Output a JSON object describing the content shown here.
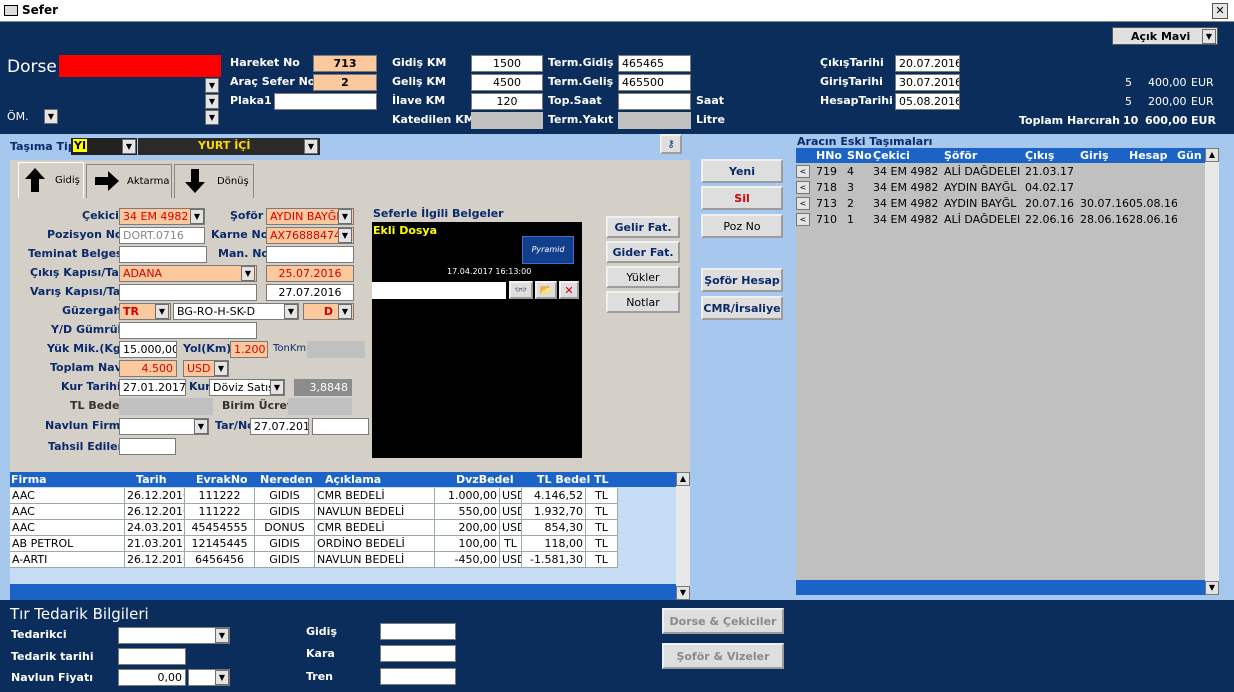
{
  "window": {
    "title": "Sefer",
    "close": "✕"
  },
  "theme": {
    "selected": "Açık Mavi"
  },
  "header": {
    "dorse_label": "Dorse",
    "om_label": "ÖM.",
    "hareket_no_label": "Hareket No",
    "hareket_no": "713",
    "arac_sefer_no_label": "Araç Sefer No",
    "arac_sefer_no": "2",
    "plaka1_label": "Plaka1",
    "plaka1": "",
    "gidis_km_label": "Gidiş KM",
    "gidis_km": "1500",
    "gelis_km_label": "Geliş KM",
    "gelis_km": "4500",
    "ilave_km_label": "İlave KM",
    "ilave_km": "120",
    "katedilen_km_label": "Katedilen KM",
    "term_gidis_label": "Term.Gidiş",
    "term_gidis": "465465",
    "term_gelis_label": "Term.Geliş",
    "term_gelis": "465500",
    "top_saat_label": "Top.Saat",
    "saat_label": "Saat",
    "term_yakit_label": "Term.Yakıt",
    "litre_label": "Litre",
    "cikis_tarihi_label": "ÇıkışTarihi",
    "cikis_tarihi": "20.07.2016",
    "giris_tarihi_label": "GirişTarihi",
    "giris_tarihi": "30.07.2016",
    "hesap_tarihi_label": "HesapTarihi",
    "hesap_tarihi": "05.08.2016",
    "harc1": [
      "5",
      "400,00",
      "EUR"
    ],
    "harc2": [
      "5",
      "200,00",
      "EUR"
    ],
    "toplam_harcirah_label": "Toplam Harcırah",
    "toplam": [
      "10",
      "600,00",
      "EUR"
    ]
  },
  "tasima": {
    "label": "Taşıma Tipi",
    "code": "YI",
    "type": "YURT İÇİ"
  },
  "tabs": [
    {
      "label": "Gidiş"
    },
    {
      "label": "Aktarma"
    },
    {
      "label": "Dönüş"
    }
  ],
  "form": {
    "cekici_label": "Çekici",
    "cekici": "34 EM 4982",
    "sofor_label": "Şoför",
    "sofor": "AYDIN BAYĞL",
    "pozisyon_label": "Pozisyon No",
    "pozisyon": "DORT.0716",
    "karne_label": "Karne No",
    "karne": "AX76888474",
    "teminat_label": "Teminat Belgesi",
    "man_label": "Man. No",
    "cikis_kapisi_label": "Çıkış Kapısı/Tar",
    "cikis_kapisi": "ADANA",
    "cikis_tar": "25.07.2016",
    "varis_label": "Varış Kapısı/Tar",
    "varis_tar": "27.07.2016",
    "guzergah_label": "Güzergah",
    "guz_country": "TR",
    "guz_route": "BG-RO-H-SK-D",
    "guz_dest": "D",
    "yd_label": "Y/D Gümrük",
    "yuk_label": "Yük Mik.(Kg)",
    "yuk": "15.000,00",
    "yol_label": "Yol(Km)",
    "yol": "1.200",
    "tonkm": "TonKm",
    "navlun_label": "Toplam Nav.",
    "navlun": "4.500",
    "currency": "USD",
    "kur_tarihi_label": "Kur Tarihi",
    "kur_tarihi": "27.01.2017",
    "kur_label": "Kur",
    "kur_type": "Döviz Satış",
    "kur_value": "3,8848",
    "tl_bedel_label": "TL Bedel",
    "birim_label": "Birim Ücret",
    "navlun_firma_label": "Navlun Firma",
    "tarno_label": "Tar/No",
    "tarno": "27.07.2016",
    "tahsil_label": "Tahsil Edilen"
  },
  "docs": {
    "title": "Seferle İlgili Belgeler",
    "ekli": "Ekli Dosya",
    "logo": "Pyramid",
    "stamp": "17.04.2017 16:13:00"
  },
  "side_buttons": {
    "gelir": "Gelir Fat.",
    "gider": "Gider Fat.",
    "yukler": "Yükler",
    "notlar": "Notlar"
  },
  "actions": {
    "yeni": "Yeni",
    "sil": "Sil",
    "poz": "Poz No",
    "sofor_hesap": "Şoför Hesap",
    "cmr": "CMR/İrsaliye"
  },
  "expenses": {
    "headers": [
      "Firma",
      "Tarih",
      "EvrakNo",
      "Nereden",
      "Açıklama",
      "DvzBedel",
      "TL Bedel",
      "TL"
    ],
    "rows": [
      [
        "AAC",
        "26.12.2016",
        "111222",
        "GIDIS",
        "CMR BEDELİ",
        "1.000,00",
        "USD",
        "4.146,52",
        "TL"
      ],
      [
        "AAC",
        "26.12.2016",
        "111222",
        "GIDIS",
        "NAVLUN BEDELİ",
        "550,00",
        "USD",
        "1.932,70",
        "TL"
      ],
      [
        "AAC",
        "24.03.2017",
        "45454555",
        "DONUS",
        "CMR BEDELİ",
        "200,00",
        "USD",
        "854,30",
        "TL"
      ],
      [
        "AB PETROL",
        "21.03.2017",
        "12145445",
        "GIDIS",
        "ORDİNO BEDELİ",
        "100,00",
        "TL",
        "118,00",
        "TL"
      ],
      [
        "A-ARTI",
        "26.12.2016",
        "6456456",
        "GIDIS",
        "NAVLUN BEDELİ",
        "-450,00",
        "USD",
        "-1.581,30",
        "TL"
      ]
    ]
  },
  "history": {
    "title": "Aracın Eski Taşımaları",
    "headers": [
      "HNo",
      "SNo",
      "Çekici",
      "Şöför",
      "Çıkış",
      "Giriş",
      "Hesap",
      "Gün"
    ],
    "rows": [
      [
        "719",
        "4",
        "34 EM 4982",
        "ALİ DAĞDELEI",
        "21.03.17",
        "",
        "",
        ""
      ],
      [
        "718",
        "3",
        "34 EM 4982",
        "AYDIN BAYĞL",
        "04.02.17",
        "",
        "",
        ""
      ],
      [
        "713",
        "2",
        "34 EM 4982",
        "AYDIN BAYĞL",
        "20.07.16",
        "30.07.16",
        "05.08.16",
        ""
      ],
      [
        "710",
        "1",
        "34 EM 4982",
        "ALİ DAĞDELEI",
        "22.06.16",
        "28.06.16",
        "28.06.16",
        ""
      ]
    ]
  },
  "supplier": {
    "title": "Tır Tedarik Bilgileri",
    "tedarikci_label": "Tedarikci",
    "tedarik_tarihi_label": "Tedarik tarihi",
    "navlun_fiyati_label": "Navlun Fiyatı",
    "navlun_fiyati": "0,00",
    "gidis_label": "Gidiş",
    "kara_label": "Kara",
    "tren_label": "Tren",
    "dorse_btn": "Dorse & Çekiciler",
    "sofor_btn": "Şoför & Vizeler"
  }
}
